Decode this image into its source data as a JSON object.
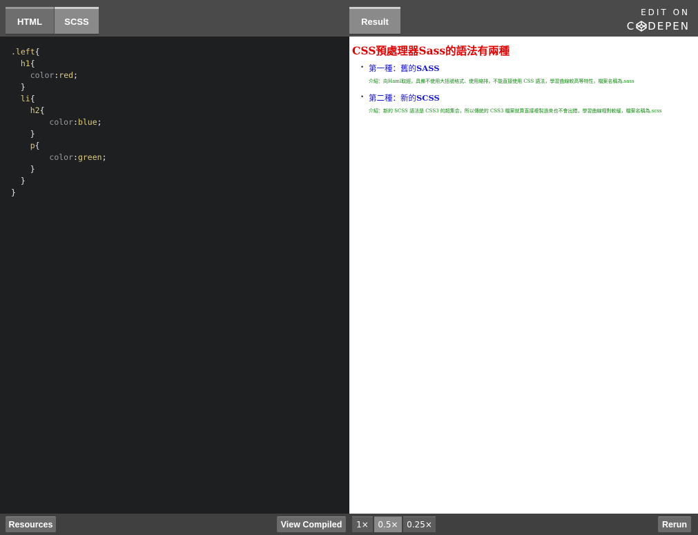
{
  "tabs": {
    "html": "HTML",
    "scss": "SCSS",
    "result": "Result"
  },
  "codepen": {
    "edit_on": "EDIT ON",
    "name_left": "C",
    "name_right": "DEPEN"
  },
  "editor": {
    "lines": [
      {
        "indent": "",
        "selector": ".left",
        "brace": "{"
      },
      {
        "indent": "  ",
        "selector": "h1",
        "brace": "{"
      },
      {
        "indent": "    ",
        "prop": "color",
        "value": "red"
      },
      {
        "indent": "  ",
        "brace": "}"
      },
      {
        "indent": "  ",
        "selector": "li",
        "brace": "{"
      },
      {
        "indent": "    ",
        "selector": "h2",
        "brace": "{"
      },
      {
        "indent": "        ",
        "prop": "color",
        "value": "blue"
      },
      {
        "indent": "    ",
        "brace": "}"
      },
      {
        "indent": "    ",
        "selector": "p",
        "brace": "{"
      },
      {
        "indent": "        ",
        "prop": "color",
        "value": "green"
      },
      {
        "indent": "    ",
        "brace": "}"
      },
      {
        "indent": "  ",
        "brace": "}"
      },
      {
        "indent": "",
        "brace": "}"
      }
    ]
  },
  "result": {
    "h1": "CSS預處理器Sass的語法有兩種",
    "items": [
      {
        "h2_prefix": "第一種：舊的",
        "h2_bold": "SASS",
        "p": "介紹：向Haml取經，具備不使用大括號格式、使用縮排，不能直接使用 CSS 語法，學習曲線較高等特性，檔案名稱為.sass"
      },
      {
        "h2_prefix": "第二種：新的",
        "h2_bold": "SCSS",
        "p": "介紹：新的 SCSS 語法是 CSS3 的超集合，所以傳統的 CSS3 檔案就算直接複製過來也不會出錯，學習曲線相對較緩，檔案名稱為.scss"
      }
    ]
  },
  "bottom": {
    "resources": "Resources",
    "view_compiled": "View Compiled",
    "zoom_1x": "1×",
    "zoom_05x": "0.5×",
    "zoom_025x": "0.25×",
    "zoom_selected": "0.5×",
    "rerun": "Rerun"
  },
  "colors": {
    "topbar": "#4a4a4a",
    "editor_bg": "#1d1f20",
    "h1": "#e30000",
    "h2": "#1515d6",
    "p": "#0a8a0a"
  }
}
